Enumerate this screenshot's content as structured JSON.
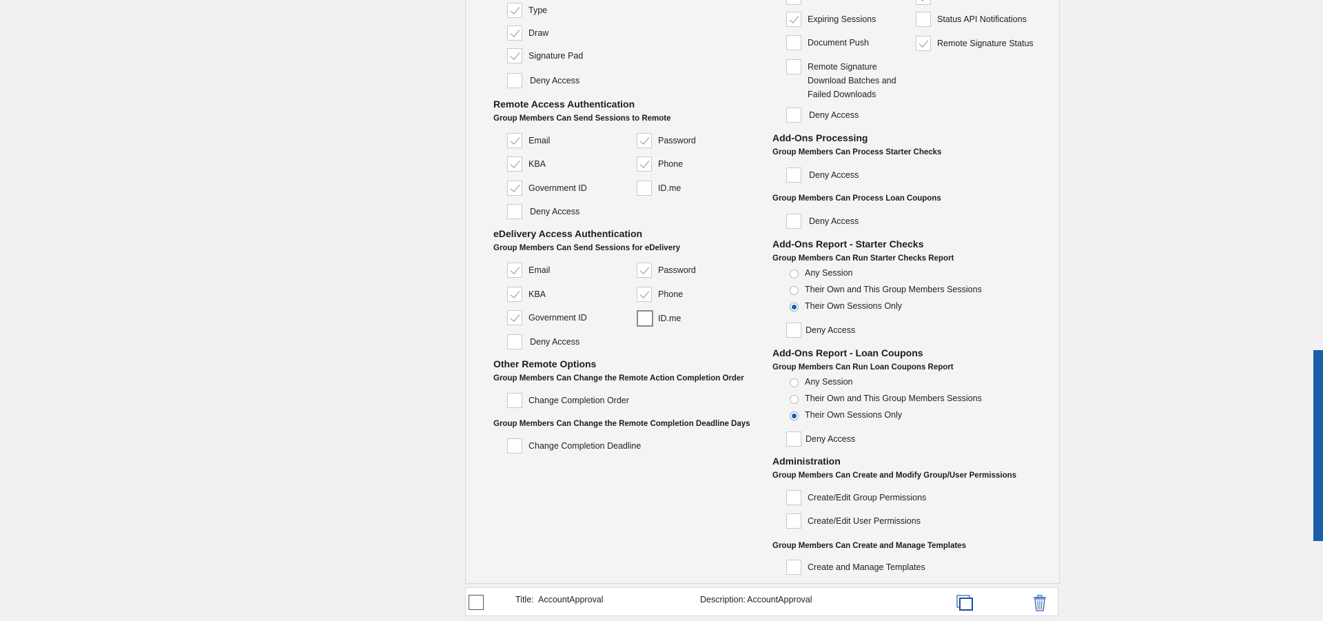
{
  "left": {
    "type": {
      "label": "Type",
      "checked": true
    },
    "draw": {
      "label": "Draw",
      "checked": true
    },
    "signature_pad": {
      "label": "Signature Pad",
      "checked": true
    },
    "sig_deny": {
      "label": "Deny Access",
      "checked": false
    },
    "remote_auth": {
      "title": "Remote Access Authentication",
      "subtitle": "Group Members Can Send Sessions to Remote",
      "email": "Email",
      "password": "Password",
      "kba": "KBA",
      "phone": "Phone",
      "gov_id": "Government ID",
      "idme": "ID.me",
      "deny": "Deny Access"
    },
    "edelivery_auth": {
      "title": "eDelivery Access Authentication",
      "subtitle": "Group Members Can Send Sessions for eDelivery",
      "email": "Email",
      "password": "Password",
      "kba": "KBA",
      "phone": "Phone",
      "gov_id": "Government ID",
      "idme": "ID.me",
      "deny": "Deny Access"
    },
    "other_remote": {
      "title": "Other Remote Options",
      "subtitle1": "Group Members Can Change the Remote Action Completion Order",
      "change_order": "Change Completion Order",
      "subtitle2": "Group Members Can Change the Remote Completion Deadline Days",
      "change_deadline": "Change Completion Deadline"
    }
  },
  "right": {
    "expiring_sessions": "Expiring Sessions",
    "status_api": "Status API Notifications",
    "document_push": "Document Push",
    "remote_sig_status": "Remote Signature Status",
    "remote_sig_download": [
      "Remote Signature",
      "Download Batches and",
      "Failed Downloads"
    ],
    "top_deny": "Deny Access",
    "addons_processing": {
      "title": "Add-Ons Processing",
      "sub1": "Group Members Can Process Starter Checks",
      "deny1": "Deny Access",
      "sub2": "Group Members Can Process Loan Coupons",
      "deny2": "Deny Access"
    },
    "report_starter": {
      "title": "Add-Ons Report - Starter Checks",
      "subtitle": "Group Members Can Run Starter Checks Report",
      "any": "Any Session",
      "own_group": "Their Own and This Group Members Sessions",
      "own_only": "Their Own Sessions Only",
      "selected": "own_only",
      "deny": "Deny Access"
    },
    "report_loan": {
      "title": "Add-Ons Report - Loan Coupons",
      "subtitle": "Group Members Can Run Loan Coupons Report",
      "any": "Any Session",
      "own_group": "Their Own and This Group Members Sessions",
      "own_only": "Their Own Sessions Only",
      "selected": "own_only",
      "deny": "Deny Access"
    },
    "administration": {
      "title": "Administration",
      "sub1": "Group Members Can Create and Modify Group/User Permissions",
      "group_perm": "Create/Edit Group Permissions",
      "user_perm": "Create/Edit User Permissions",
      "sub2": "Group Members Can Create and Manage Templates",
      "templates": "Create and Manage Templates"
    }
  },
  "footer": {
    "title_label": "Title:",
    "title_value": "AccountApproval",
    "description_label": "Description:",
    "description_value": "AccountApproval"
  },
  "icons": {
    "copy": "copy-icon",
    "delete": "trash-icon"
  },
  "colors": {
    "radio_selected": "#1b5db5",
    "scrollbar": "#1b5ea8"
  }
}
